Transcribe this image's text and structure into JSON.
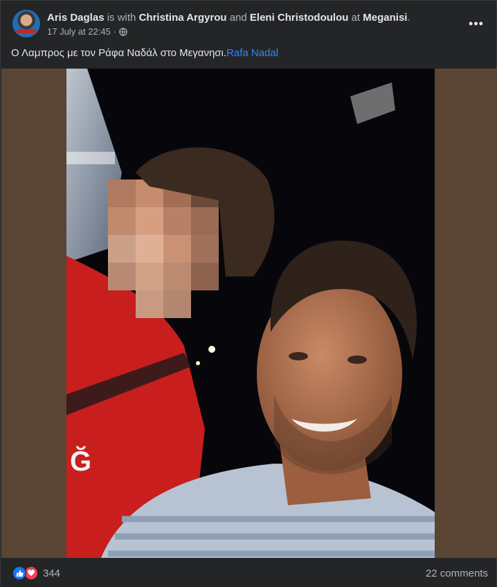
{
  "post": {
    "author": "Aris Daglas",
    "with_text": "is with",
    "tagged_1": "Christina Argyrou",
    "and_text": "and",
    "tagged_2": "Eleni Christodoulou",
    "at_text": "at",
    "location": "Meganisi",
    "period": ".",
    "timestamp": "17 July at 22:45",
    "separator": "·",
    "privacy_icon": "globe-icon",
    "more_icon": "more-options-icon",
    "more_label": "•••",
    "text": "Ο Λαμπρος με τον Ράφα Ναδάλ στο Μεγανησι.",
    "mention": "Rafa Nadal"
  },
  "footer": {
    "reaction_icons": [
      "like-icon",
      "love-icon"
    ],
    "reaction_count": "344",
    "comments": "22 comments"
  },
  "colors": {
    "background": "#242526",
    "text_primary": "#e4e6eb",
    "text_secondary": "#b0b3b8",
    "link": "#2d88ff",
    "like_blue": "#1877f2",
    "love_red": "#f33e58",
    "photo_letterbox": "#5a4534"
  }
}
